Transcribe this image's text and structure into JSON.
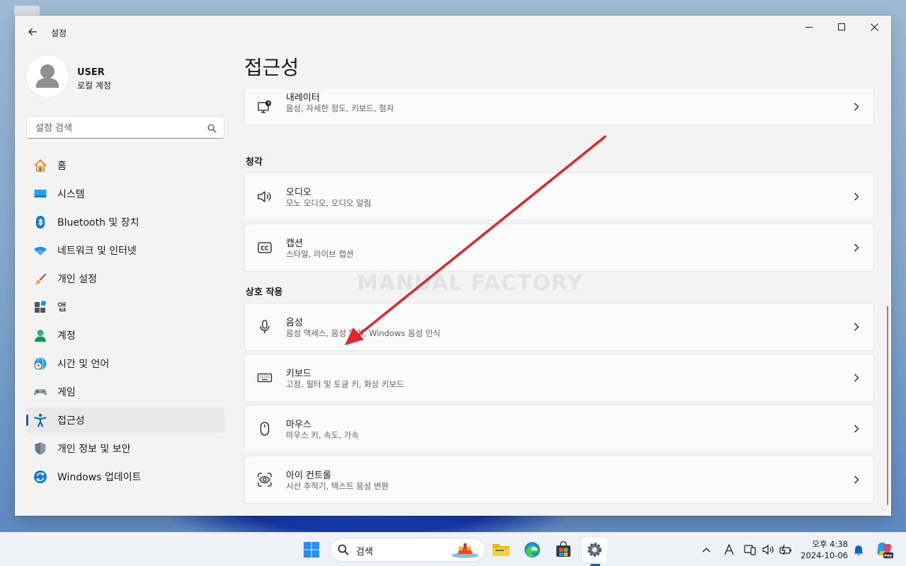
{
  "window": {
    "title": "설정"
  },
  "profile": {
    "name": "USER",
    "account_type": "로컬 계정"
  },
  "search": {
    "placeholder": "설정 검색"
  },
  "sidebar": {
    "items": [
      {
        "label": "홈",
        "icon": "home-icon"
      },
      {
        "label": "시스템",
        "icon": "system-icon"
      },
      {
        "label": "Bluetooth 및 장치",
        "icon": "bluetooth-icon"
      },
      {
        "label": "네트워크 및 인터넷",
        "icon": "wifi-icon"
      },
      {
        "label": "개인 설정",
        "icon": "brush-icon"
      },
      {
        "label": "앱",
        "icon": "apps-icon"
      },
      {
        "label": "계정",
        "icon": "account-icon"
      },
      {
        "label": "시간 및 언어",
        "icon": "time-language-icon"
      },
      {
        "label": "게임",
        "icon": "gamepad-icon"
      },
      {
        "label": "접근성",
        "icon": "accessibility-icon",
        "active": true
      },
      {
        "label": "개인 정보 및 보안",
        "icon": "shield-icon"
      },
      {
        "label": "Windows 업데이트",
        "icon": "update-icon"
      }
    ]
  },
  "main": {
    "title": "접근성",
    "narrator": {
      "title": "내레이터",
      "subtitle": "음성, 자세한 정도, 키보드, 점자",
      "icon": "narrator-icon"
    },
    "sections": [
      {
        "heading": "청각",
        "items": [
          {
            "title": "오디오",
            "subtitle": "모노 오디오, 오디오 알림",
            "icon": "speaker-icon"
          },
          {
            "title": "캡션",
            "subtitle": "스타일, 라이브 캡션",
            "icon": "captions-icon"
          }
        ]
      },
      {
        "heading": "상호 작용",
        "items": [
          {
            "title": "음성",
            "subtitle": "음성 액세스, 음성 입력, Windows 음성 인식",
            "icon": "microphone-icon"
          },
          {
            "title": "키보드",
            "subtitle": "고정, 필터 및 토글 키, 화상 키보드",
            "icon": "keyboard-icon"
          },
          {
            "title": "마우스",
            "subtitle": "마우스 키, 속도, 가속",
            "icon": "mouse-icon"
          },
          {
            "title": "아이 컨트롤",
            "subtitle": "시선 추적기, 텍스트 음성 변환",
            "icon": "eye-control-icon"
          }
        ]
      }
    ]
  },
  "watermark": "MANUAL FACTORY",
  "annotation": {
    "color": "#e1262b"
  },
  "taskbar": {
    "search_label": "검색",
    "clock": {
      "time": "오후 4:38",
      "date": "2024-10-06"
    }
  },
  "colors": {
    "accent": "#0067c0",
    "window_bg": "#f3f3f3",
    "card_bg": "#fbfbfb"
  }
}
